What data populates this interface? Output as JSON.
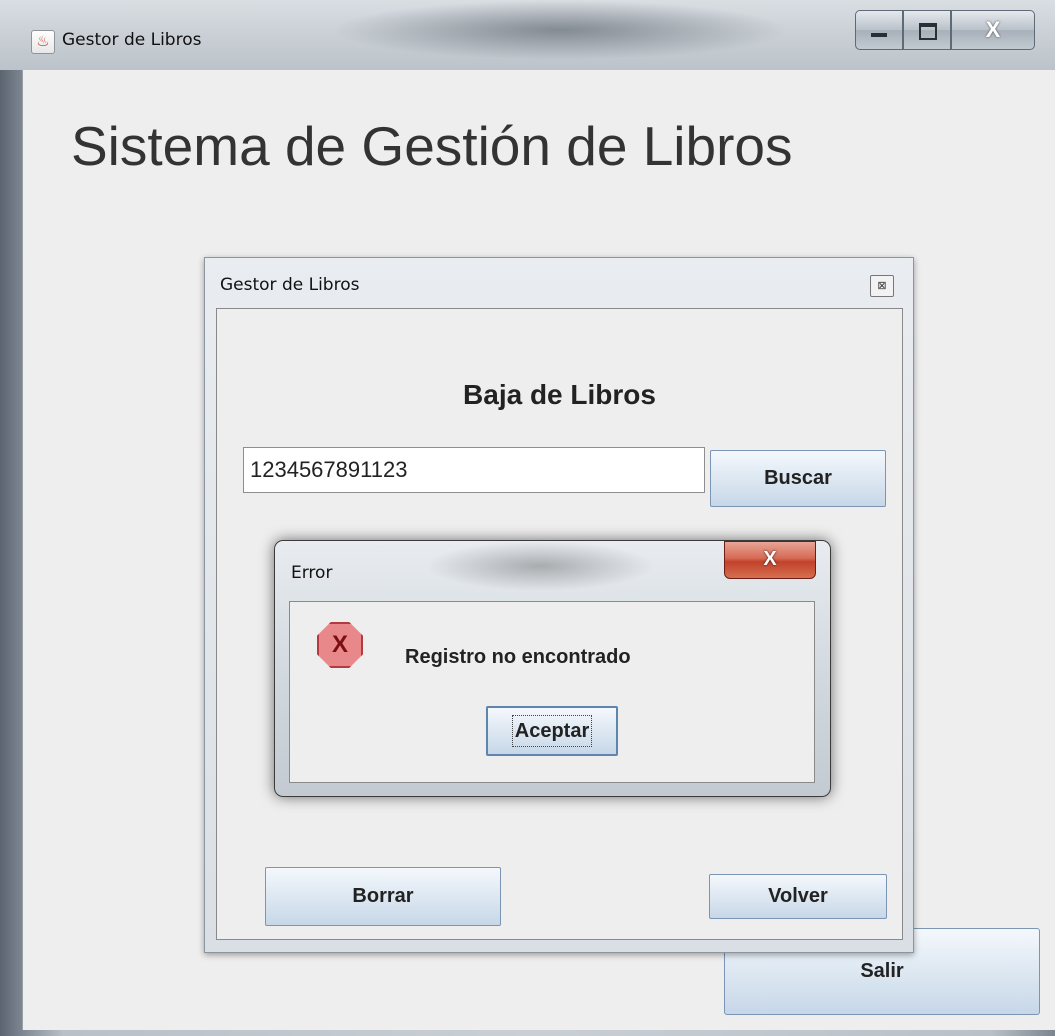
{
  "main_window": {
    "title": "Gestor de Libros",
    "app_icon": "java-icon",
    "heading": "Sistema de Gestión de Libros",
    "salir_label": "Salir",
    "controls": {
      "minimize_icon": "minimize-icon",
      "maximize_icon": "maximize-icon",
      "close_glyph": "X"
    }
  },
  "child_dialog": {
    "title": "Gestor de Libros",
    "close_glyph": "⊠",
    "heading": "Baja de Libros",
    "isbn_value": "1234567891123",
    "buscar_label": "Buscar",
    "borrar_label": "Borrar",
    "volver_label": "Volver"
  },
  "error_dialog": {
    "title": "Error",
    "close_glyph": "X",
    "icon": "error-icon",
    "icon_glyph": "X",
    "message": "Registro no encontrado",
    "aceptar_label": "Aceptar"
  }
}
